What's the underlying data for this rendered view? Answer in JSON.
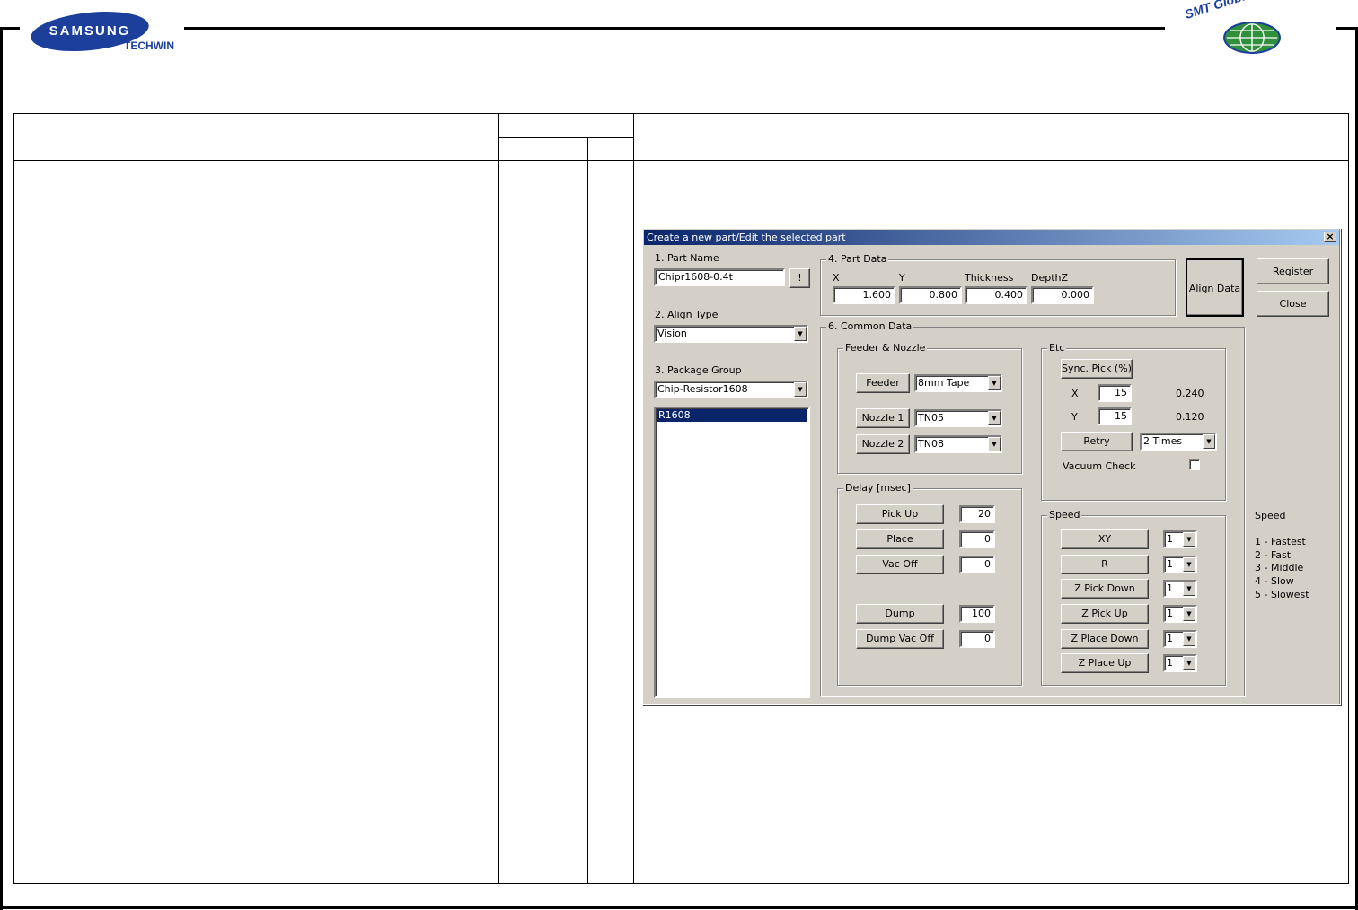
{
  "header": {
    "samsung_logo": "SAMSUNG",
    "techwin_logo": "TECHWIN",
    "training_logo": "SMT Global Training Center"
  },
  "dialog": {
    "title": "Create a new part/Edit the selected part",
    "close_glyph": "×",
    "part_name": {
      "label": "1. Part Name",
      "value": "Chipr1608-0.4t",
      "lookup_button": "!"
    },
    "align_type": {
      "label": "2. Align Type",
      "value": "Vision"
    },
    "package_group": {
      "label": "3. Package Group",
      "value": "Chip-Resistor1608",
      "list_items": [
        "R1608"
      ]
    },
    "part_data": {
      "title": "4. Part Data",
      "x_label": "X",
      "x_value": "1.600",
      "y_label": "Y",
      "y_value": "0.800",
      "thickness_label": "Thickness",
      "thickness_value": "0.400",
      "depthz_label": "DepthZ",
      "depthz_value": "0.000"
    },
    "align_data_button": "Align Data",
    "register_button": "Register",
    "close_button": "Close",
    "common_data": {
      "title": "6. Common Data",
      "feeder_nozzle": {
        "title": "Feeder & Nozzle",
        "feeder_label": "Feeder",
        "feeder_value": "8mm Tape",
        "nozzle1_label": "Nozzle 1",
        "nozzle1_value": "TN05",
        "nozzle2_label": "Nozzle 2",
        "nozzle2_value": "TN08"
      },
      "etc": {
        "title": "Etc",
        "sync_pick_label": "Sync. Pick (%)",
        "x_label": "X",
        "x_value": "15",
        "x_calc": "0.240",
        "y_label": "Y",
        "y_value": "15",
        "y_calc": "0.120",
        "retry_label": "Retry",
        "retry_value": "2 Times",
        "vacuum_check_label": "Vacuum Check",
        "vacuum_check_checked": false
      },
      "delay": {
        "title": "Delay [msec]",
        "pickup_label": "Pick Up",
        "pickup_value": "20",
        "place_label": "Place",
        "place_value": "0",
        "vacoff_label": "Vac Off",
        "vacoff_value": "0",
        "dump_label": "Dump",
        "dump_value": "100",
        "dumpvacoff_label": "Dump Vac Off",
        "dumpvacoff_value": "0"
      },
      "speed": {
        "title": "Speed",
        "rows": [
          {
            "label": "XY",
            "value": "1"
          },
          {
            "label": "R",
            "value": "1"
          },
          {
            "label": "Z Pick Down",
            "value": "1"
          },
          {
            "label": "Z Pick Up",
            "value": "1"
          },
          {
            "label": "Z Place Down",
            "value": "1"
          },
          {
            "label": "Z Place Up",
            "value": "1"
          }
        ]
      }
    },
    "speed_legend": {
      "title": "Speed",
      "items": [
        "1 - Fastest",
        "2 - Fast",
        "3 - Middle",
        "4 - Slow",
        "5 - Slowest"
      ]
    },
    "dropdown_glyph": "▼"
  }
}
